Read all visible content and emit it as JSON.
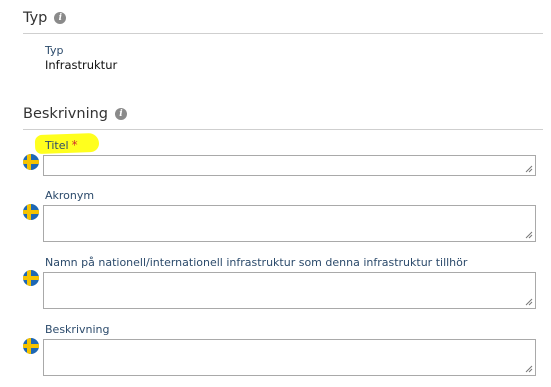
{
  "typ_section": {
    "title": "Typ",
    "field_label": "Typ",
    "field_value": "Infrastruktur"
  },
  "beskrivning_section": {
    "title": "Beskrivning",
    "fields": [
      {
        "label": "Titel",
        "required": "*",
        "value": ""
      },
      {
        "label": "Akronym",
        "value": ""
      },
      {
        "label": "Namn på nationell/internationell infrastruktur som denna infrastruktur tillhör",
        "value": ""
      },
      {
        "label": "Beskrivning",
        "value": ""
      }
    ]
  },
  "icons": {
    "info": "info-icon",
    "flag": "swedish-flag-icon"
  },
  "colors": {
    "highlight": "#ffff1e",
    "required": "#d0312d",
    "label": "#2b4a6b"
  }
}
